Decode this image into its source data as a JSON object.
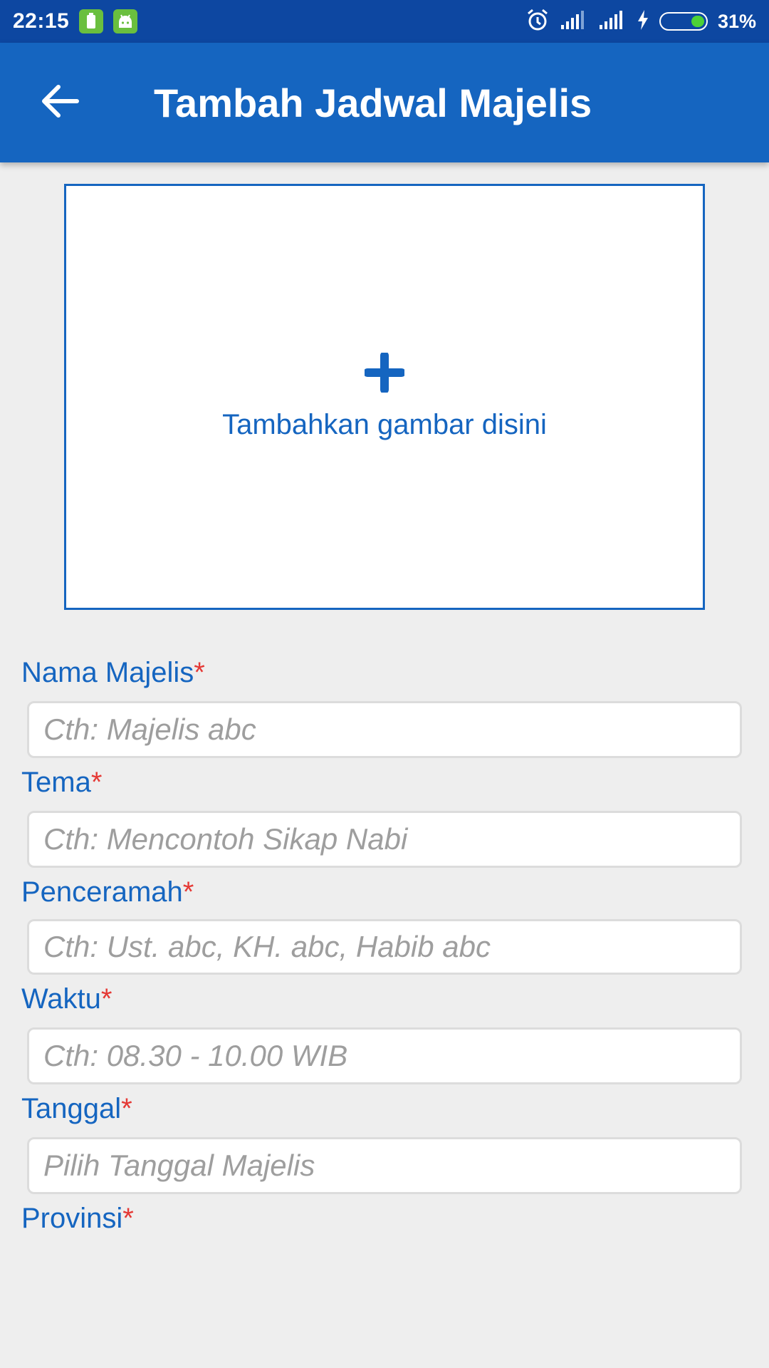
{
  "status_bar": {
    "time": "22:15",
    "battery_percent": "31%",
    "battery_level": 0.31,
    "icons": [
      "battery-notification-icon",
      "android-notification-icon",
      "alarm-icon",
      "signal-1-icon",
      "signal-2-icon",
      "charging-icon",
      "battery-icon"
    ]
  },
  "app_bar": {
    "title": "Tambah Jadwal Majelis",
    "back_icon": "arrow-left-icon",
    "color": "#1565c0"
  },
  "image_upload": {
    "label": "Tambahkan gambar disini",
    "icon": "plus-icon"
  },
  "form": {
    "required_marker": "*",
    "fields": [
      {
        "label": "Nama Majelis",
        "placeholder": "Cth: Majelis abc",
        "value": ""
      },
      {
        "label": "Tema",
        "placeholder": "Cth: Mencontoh Sikap Nabi",
        "value": ""
      },
      {
        "label": "Penceramah",
        "placeholder": "Cth: Ust. abc, KH. abc, Habib abc",
        "value": ""
      },
      {
        "label": "Waktu",
        "placeholder": "Cth: 08.30 - 10.00 WIB",
        "value": ""
      },
      {
        "label": "Tanggal",
        "placeholder": "Pilih Tanggal Majelis",
        "value": ""
      },
      {
        "label": "Provinsi",
        "placeholder": "",
        "value": ""
      }
    ]
  },
  "colors": {
    "primary": "#1565c0",
    "status_bar": "#0d47a1",
    "required": "#e53935",
    "background": "#eeeeee"
  }
}
